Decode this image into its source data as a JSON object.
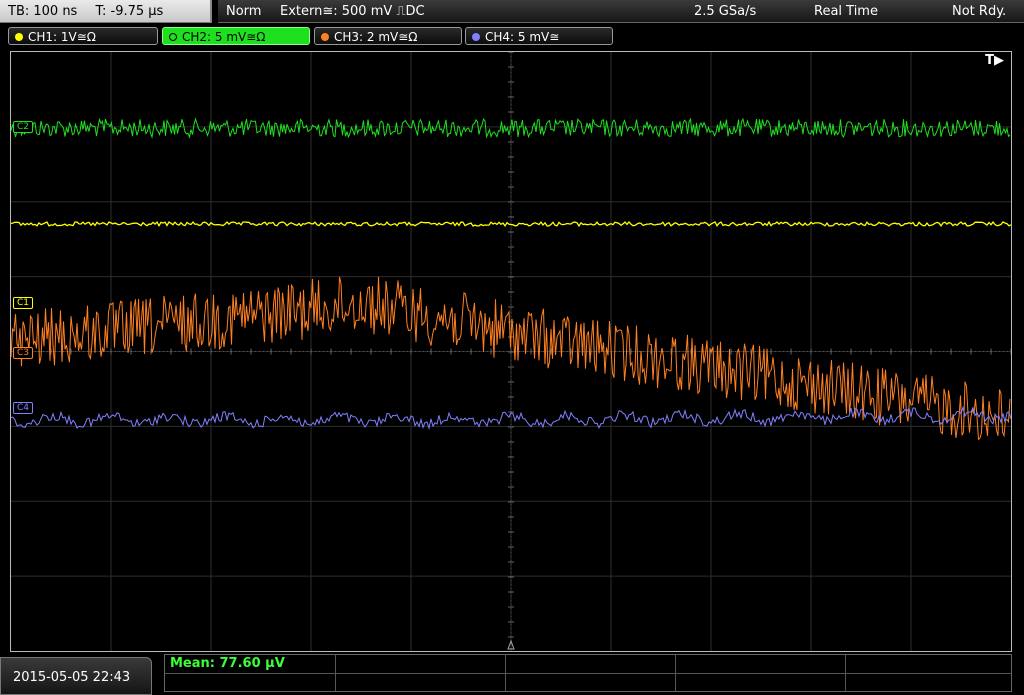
{
  "header": {
    "timebase": "TB: 100 ns",
    "trigger_time": "T: -9.75 µs",
    "mode": "Norm",
    "trigger_source": "Extern≅: 500 mV ⎍DC",
    "sample_rate": "2.5 GSa/s",
    "acq_mode": "Real Time",
    "status": "Not Rdy."
  },
  "channels": [
    {
      "label": "CH1: 1V≅Ω",
      "color": "#ffff00",
      "active": false
    },
    {
      "label": "CH2: 5 mV≅Ω",
      "color": "#1fe01f",
      "active": true
    },
    {
      "label": "CH3: 2 mV≅Ω",
      "color": "#ff8020",
      "active": false
    },
    {
      "label": "CH4: 5 mV≅",
      "color": "#8080ff",
      "active": false
    }
  ],
  "markers": {
    "c1": "C1",
    "c3": "C3",
    "c4": "C4",
    "c2": "C2",
    "trigger_flag": "T▶"
  },
  "footer": {
    "datetime": "2015-05-05 22:43",
    "measurement": "Mean: 77.60 µV"
  }
}
